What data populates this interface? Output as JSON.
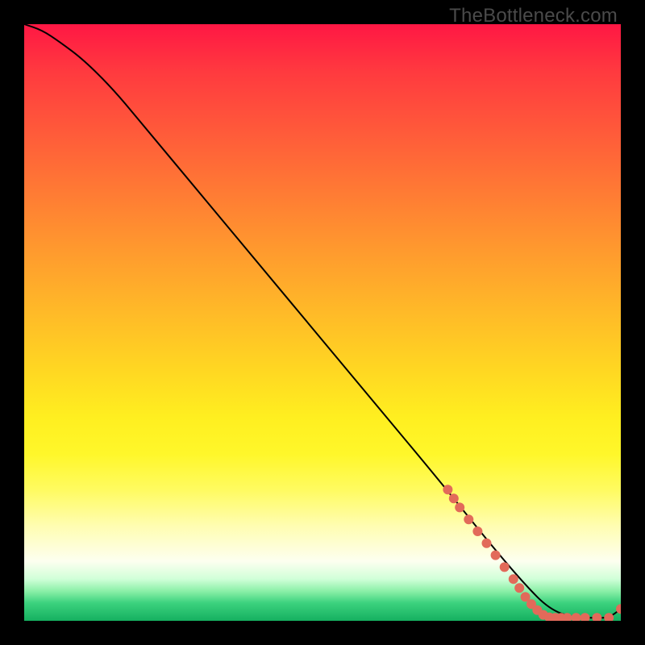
{
  "watermark": "TheBottleneck.com",
  "colors": {
    "background": "#000000",
    "curve": "#000000",
    "marker": "#e26a5a",
    "gradient_top": "#ff1744",
    "gradient_mid": "#ffd722",
    "gradient_bottom": "#15b060"
  },
  "chart_data": {
    "type": "line",
    "title": "",
    "xlabel": "",
    "ylabel": "",
    "xlim": [
      0,
      100
    ],
    "ylim": [
      0,
      100
    ],
    "series": [
      {
        "name": "bottleneck-curve",
        "x": [
          0,
          3,
          6,
          10,
          15,
          20,
          30,
          40,
          50,
          60,
          70,
          78,
          84,
          88,
          92,
          96,
          98,
          100
        ],
        "y": [
          100,
          99,
          97,
          94,
          89,
          83,
          71,
          59,
          47,
          35,
          23,
          13,
          6,
          2,
          0.5,
          0.5,
          0.5,
          2
        ]
      }
    ],
    "markers": [
      {
        "x": 71,
        "y": 22
      },
      {
        "x": 72,
        "y": 20.5
      },
      {
        "x": 73,
        "y": 19
      },
      {
        "x": 74.5,
        "y": 17
      },
      {
        "x": 76,
        "y": 15
      },
      {
        "x": 77.5,
        "y": 13
      },
      {
        "x": 79,
        "y": 11
      },
      {
        "x": 80.5,
        "y": 9
      },
      {
        "x": 82,
        "y": 7
      },
      {
        "x": 83,
        "y": 5.5
      },
      {
        "x": 84,
        "y": 4
      },
      {
        "x": 85,
        "y": 2.8
      },
      {
        "x": 86,
        "y": 1.8
      },
      {
        "x": 87,
        "y": 1
      },
      {
        "x": 88,
        "y": 0.6
      },
      {
        "x": 89,
        "y": 0.5
      },
      {
        "x": 90,
        "y": 0.5
      },
      {
        "x": 91,
        "y": 0.5
      },
      {
        "x": 92.5,
        "y": 0.5
      },
      {
        "x": 94,
        "y": 0.5
      },
      {
        "x": 96,
        "y": 0.5
      },
      {
        "x": 98,
        "y": 0.5
      },
      {
        "x": 100,
        "y": 2
      }
    ]
  }
}
